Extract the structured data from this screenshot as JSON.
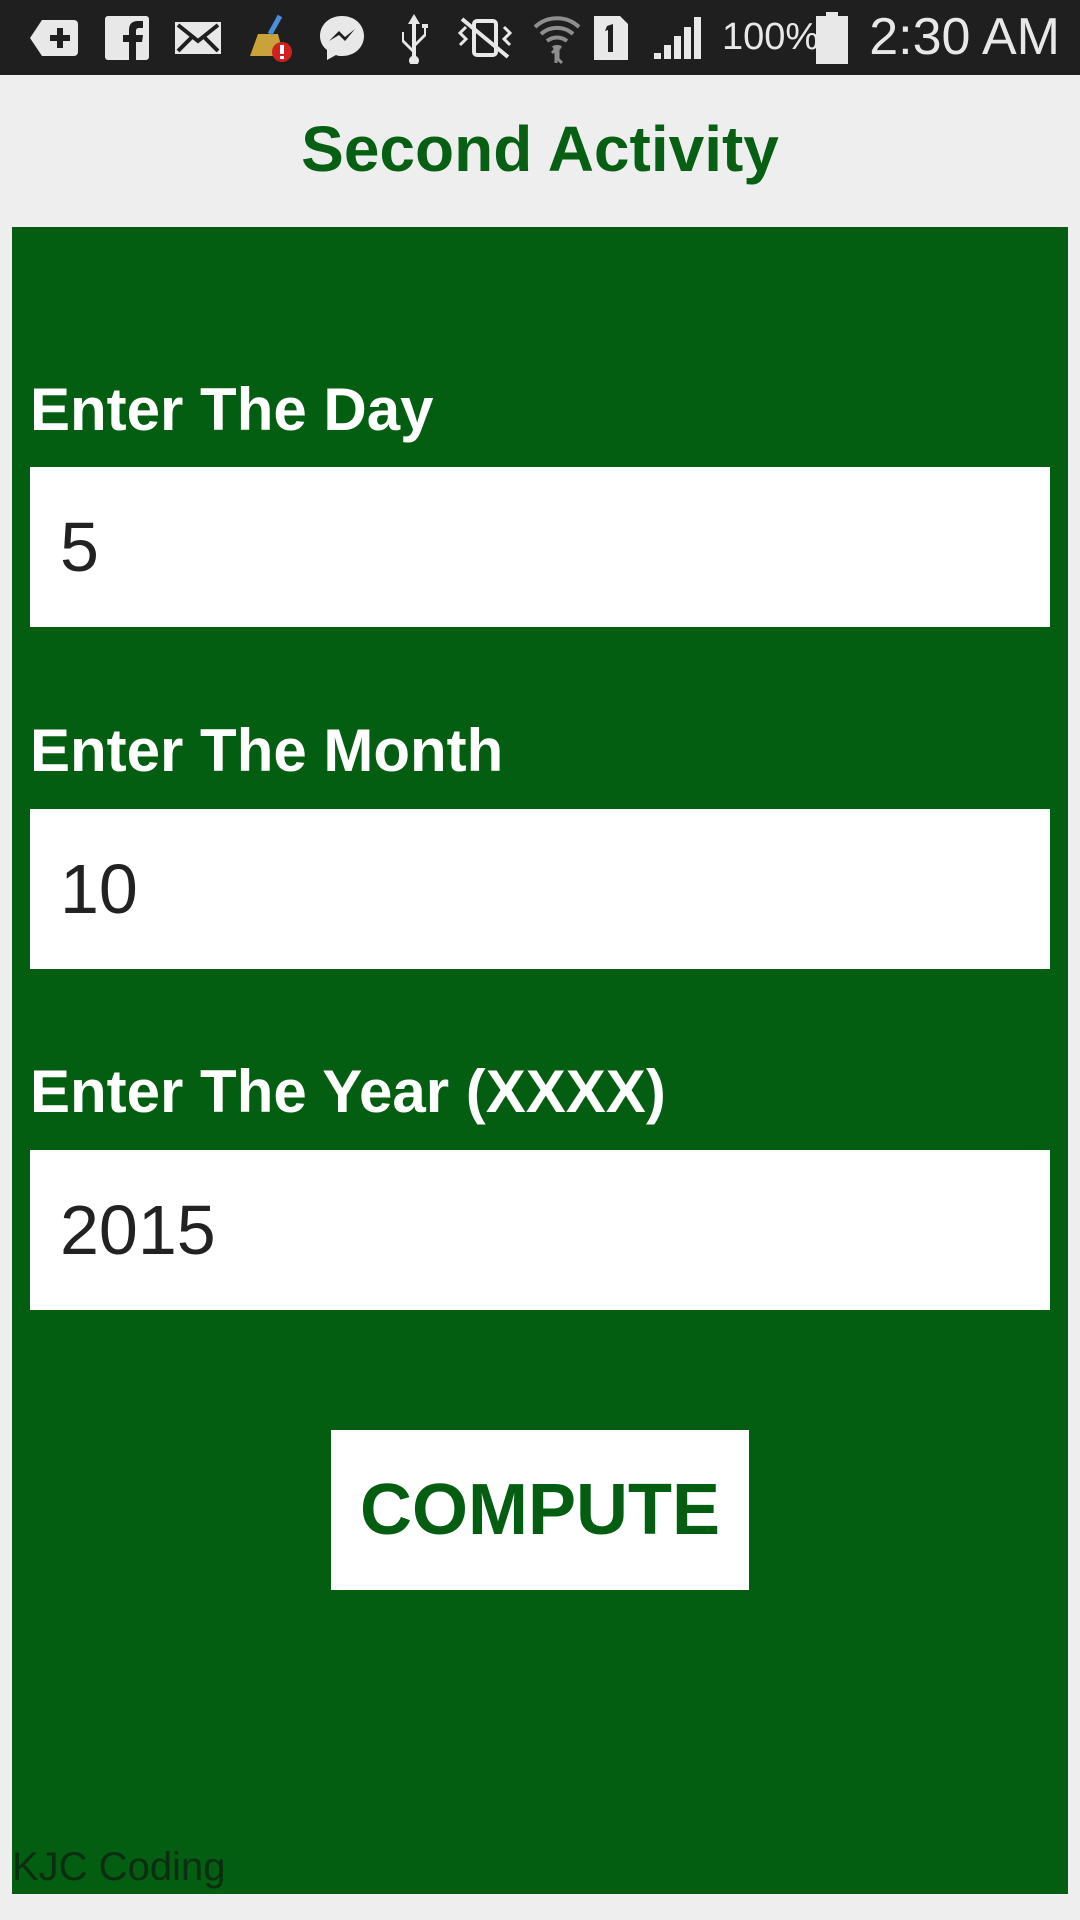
{
  "status_bar": {
    "icons": [
      "add-box-icon",
      "facebook-icon",
      "mail-icon",
      "cleaner-icon",
      "messenger-icon",
      "usb-icon",
      "vibrate-icon",
      "wifi-icon",
      "sim-1-icon",
      "signal-icon",
      "battery-icon"
    ],
    "battery_percent": "100%",
    "time": "2:30 AM"
  },
  "header": {
    "title": "Second Activity"
  },
  "form": {
    "day_label": "Enter The Day",
    "day_value": "5",
    "month_label": "Enter The Month",
    "month_value": "10",
    "year_label": "Enter The Year (XXXX)",
    "year_value": "2015",
    "compute_label": "COMPUTE"
  },
  "footer": {
    "text": "KJC Coding"
  },
  "colors": {
    "accent_green": "#045e12",
    "title_green": "#065f13",
    "background": "#eeeeee",
    "status_bar": "#1f1f1f"
  }
}
